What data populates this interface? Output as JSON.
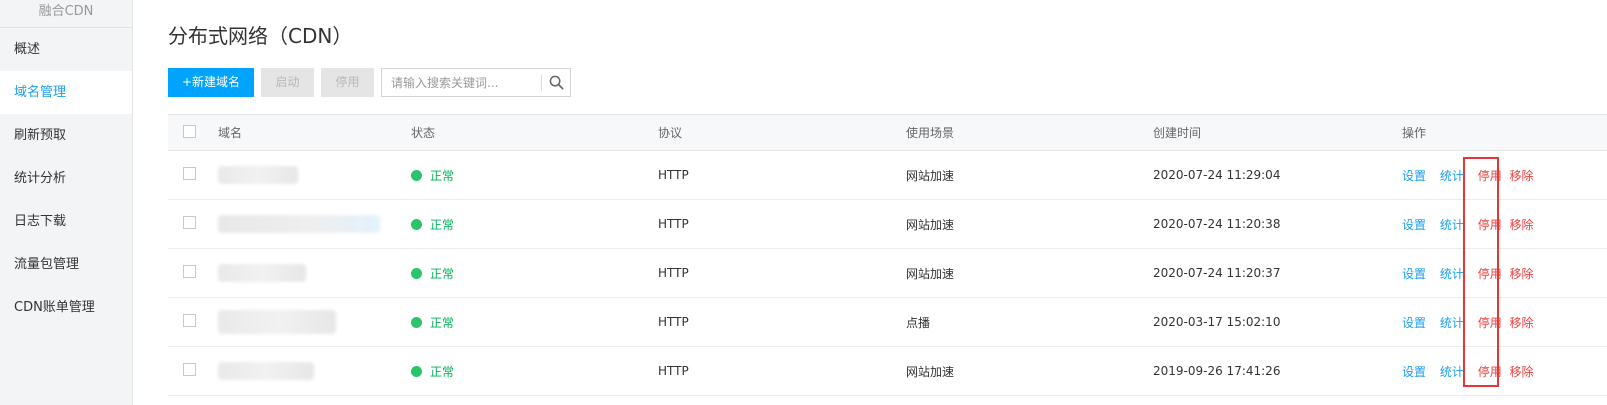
{
  "sidebar": {
    "header": "融合CDN",
    "items": [
      {
        "label": "概述",
        "active": false
      },
      {
        "label": "域名管理",
        "active": true
      },
      {
        "label": "刷新预取",
        "active": false
      },
      {
        "label": "统计分析",
        "active": false
      },
      {
        "label": "日志下载",
        "active": false
      },
      {
        "label": "流量包管理",
        "active": false
      },
      {
        "label": "CDN账单管理",
        "active": false
      }
    ]
  },
  "page": {
    "title": "分布式网络（CDN）"
  },
  "toolbar": {
    "new_domain_label": "+新建域名",
    "start_label": "启动",
    "stop_label": "停用",
    "search_placeholder": "请输入搜索关键词...",
    "search_icon": "search-icon"
  },
  "table": {
    "columns": [
      "域名",
      "状态",
      "协议",
      "使用场景",
      "创建时间",
      "操作"
    ],
    "rows": [
      {
        "status": "正常",
        "protocol": "HTTP",
        "scene": "网站加速",
        "created": "2020-07-24 11:29:04"
      },
      {
        "status": "正常",
        "protocol": "HTTP",
        "scene": "网站加速",
        "created": "2020-07-24 11:20:38"
      },
      {
        "status": "正常",
        "protocol": "HTTP",
        "scene": "网站加速",
        "created": "2020-07-24 11:20:37"
      },
      {
        "status": "正常",
        "protocol": "HTTP",
        "scene": "点播",
        "created": "2020-03-17 15:02:10"
      },
      {
        "status": "正常",
        "protocol": "HTTP",
        "scene": "网站加速",
        "created": "2019-09-26 17:41:26"
      }
    ],
    "ops": {
      "settings": "设置",
      "stats": "统计",
      "disable": "停用",
      "remove": "移除"
    }
  },
  "colors": {
    "accent": "#00a4ff",
    "link": "#1a9ff0",
    "danger": "#ef3e3e",
    "ok": "#2bc46b",
    "highlight": "#e43636"
  }
}
